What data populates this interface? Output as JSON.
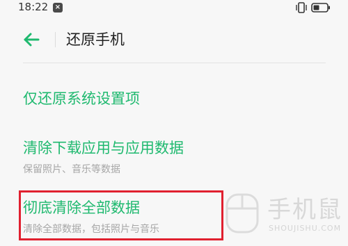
{
  "status_bar": {
    "time": "18:22",
    "notification_icon": "close-box-icon",
    "vibrate_icon": "vibrate-icon",
    "battery_icon": "battery-icon"
  },
  "header": {
    "back_icon": "arrow-left-icon",
    "title": "还原手机"
  },
  "options": [
    {
      "title": "仅还原系统设置项",
      "subtitle": ""
    },
    {
      "title": "清除下载应用与应用数据",
      "subtitle": "保留照片、音乐等数据"
    },
    {
      "title": "彻底清除全部数据",
      "subtitle": "清除全部数据，包括照片与音乐"
    }
  ],
  "watermark": {
    "text": "手机鼠",
    "sub": "SHOUJISHU.COM"
  },
  "colors": {
    "accent": "#1fb96f",
    "highlight": "#e0202f",
    "background": "#f7f7f7"
  }
}
